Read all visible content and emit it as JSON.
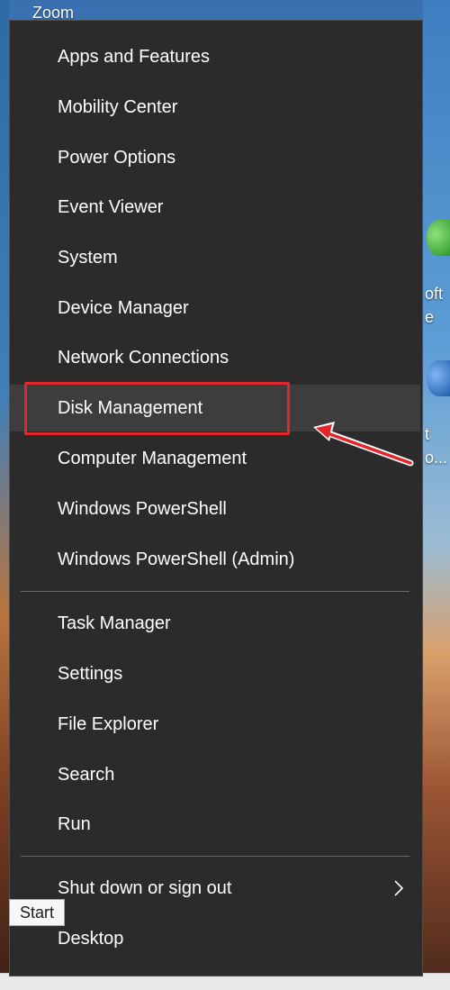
{
  "desktop": {
    "zoom_label": "Zoom",
    "side_text_1": "oft",
    "side_text_2": "e",
    "side_text_3": "t",
    "side_text_4": "o..."
  },
  "menu": {
    "group1": [
      {
        "label": "Apps and Features"
      },
      {
        "label": "Mobility Center"
      },
      {
        "label": "Power Options"
      },
      {
        "label": "Event Viewer"
      },
      {
        "label": "System"
      },
      {
        "label": "Device Manager"
      },
      {
        "label": "Network Connections"
      },
      {
        "label": "Disk Management",
        "highlighted": true
      },
      {
        "label": "Computer Management"
      },
      {
        "label": "Windows PowerShell"
      },
      {
        "label": "Windows PowerShell (Admin)"
      }
    ],
    "group2": [
      {
        "label": "Task Manager"
      },
      {
        "label": "Settings"
      },
      {
        "label": "File Explorer"
      },
      {
        "label": "Search"
      },
      {
        "label": "Run"
      }
    ],
    "group3": [
      {
        "label": "Shut down or sign out",
        "has_submenu": true
      },
      {
        "label": "Desktop"
      }
    ]
  },
  "tooltip": {
    "label": "Start"
  },
  "colors": {
    "menu_bg": "#2b2b2b",
    "highlight_bg": "#3d3d3d",
    "callout_red": "#e3262c",
    "text": "#ffffff"
  }
}
